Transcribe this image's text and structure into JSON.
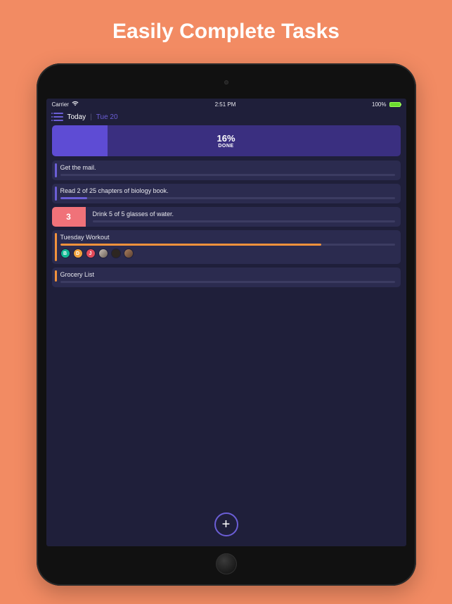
{
  "promo": {
    "title": "Easily Complete Tasks"
  },
  "status": {
    "carrier": "Carrier",
    "time": "2:51 PM",
    "battery_pct": "100%"
  },
  "header": {
    "title": "Today",
    "separator": "|",
    "date": "Tue 20"
  },
  "progress": {
    "percent": 16,
    "percent_label": "16%",
    "done_label": "DONE"
  },
  "tasks": [
    {
      "title": "Get the mail.",
      "accent": "#6b5ed6",
      "fill_pct": 0,
      "fill_color": "#6b5ed6"
    },
    {
      "title": "Read 2 of 25 chapters of biology book.",
      "accent": "#6b5ed6",
      "fill_pct": 8,
      "fill_color": "#6b5ed6"
    },
    {
      "title": "Drink 5 of 5 glasses of water.",
      "accent": "#f07279",
      "counter": "3",
      "fill_pct": 0,
      "fill_color": "#f07279"
    },
    {
      "title": "Tuesday Workout",
      "accent": "#f2923c",
      "fill_pct": 78,
      "fill_color": "#f2923c",
      "avatars": [
        {
          "letter": "B",
          "class": "av-a"
        },
        {
          "letter": "D",
          "class": "av-b"
        },
        {
          "letter": "J",
          "class": "av-c"
        },
        {
          "letter": "",
          "class": "av-d"
        },
        {
          "letter": "",
          "class": "av-e"
        },
        {
          "letter": "",
          "class": "av-f"
        }
      ]
    },
    {
      "title": "Grocery List",
      "accent": "#f2923c",
      "fill_pct": 0,
      "fill_color": "#f2923c",
      "short": true
    }
  ],
  "add_button": {
    "glyph": "+"
  }
}
